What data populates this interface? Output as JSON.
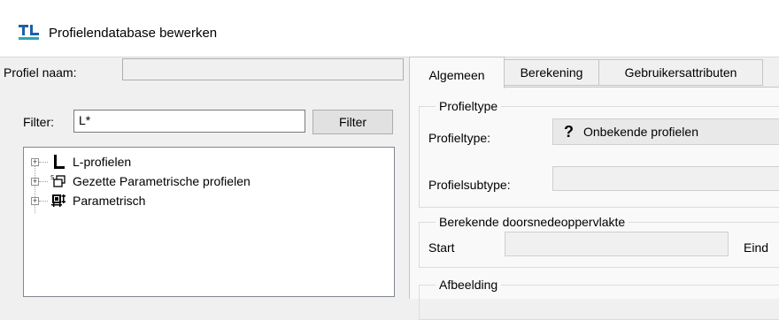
{
  "window": {
    "title": "Profielendatabase bewerken"
  },
  "left": {
    "profile_name_label": "Profiel naam:",
    "profile_name_value": "",
    "filter_label": "Filter:",
    "filter_value": "L*",
    "filter_button": "Filter",
    "tree": [
      {
        "label": "L-profielen",
        "icon": "l-profile-icon",
        "expander": "+"
      },
      {
        "label": "Gezette Parametrische profielen",
        "icon": "folded-parametric-icon",
        "expander": "+"
      },
      {
        "label": "Parametrisch",
        "icon": "parametric-icon",
        "expander": "+"
      }
    ]
  },
  "tabs": [
    {
      "label": "Algemeen",
      "active": true
    },
    {
      "label": "Berekening",
      "active": false
    },
    {
      "label": "Gebruikersattributen",
      "active": false
    }
  ],
  "general": {
    "profiletype_group": "Profieltype",
    "profiletype_label": "Profieltype:",
    "profiletype_value": "Onbekende profielen",
    "profiletype_icon": "?",
    "subtype_label": "Profielsubtype:",
    "subtype_value": "",
    "area_group": "Berekende doorsnedeoppervlakte",
    "area_start_label": "Start",
    "area_end_label": "Eind",
    "area_start_value": "",
    "image_group": "Afbeelding"
  },
  "colors": {
    "accent": "#1f5fa8",
    "icon_dark": "#000000"
  }
}
